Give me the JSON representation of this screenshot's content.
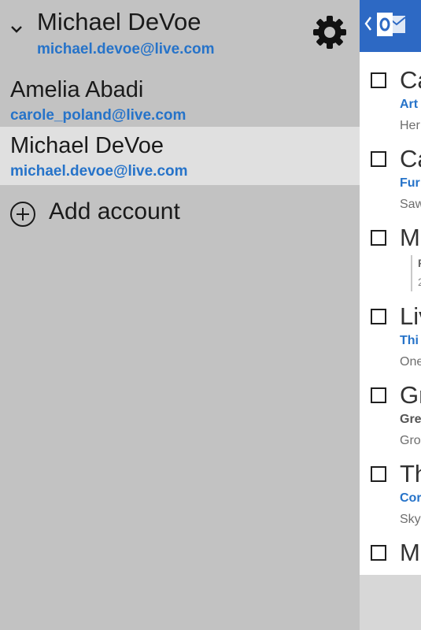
{
  "header": {
    "name": "Michael DeVoe",
    "email": "michael.devoe@live.com"
  },
  "accounts": [
    {
      "name": "Amelia Abadi",
      "email": "carole_poland@live.com",
      "selected": false
    },
    {
      "name": "Michael DeVoe",
      "email": "michael.devoe@live.com",
      "selected": true
    }
  ],
  "add_account": {
    "label": "Add account"
  },
  "mail_list": {
    "items": [
      {
        "sender": "Ca",
        "subject": "Art",
        "preview": "Her",
        "subject_color": "#2673c9"
      },
      {
        "sender": "Ca",
        "subject": "Fur",
        "preview": "Saw",
        "subject_color": "#2673c9"
      },
      {
        "sender": "M",
        "quote_line1": "F",
        "quote_line2": "2"
      },
      {
        "sender": "Liv",
        "subject": "Thi",
        "preview": "One",
        "subject_color": "#2673c9"
      },
      {
        "sender": "Gr",
        "subject": "Gre",
        "preview": "Gro",
        "subject_color": "#555555"
      },
      {
        "sender": "Th",
        "subject": "Cor",
        "preview": "Sky",
        "subject_color": "#2673c9"
      },
      {
        "sender": "M"
      }
    ]
  },
  "colors": {
    "drawer_bg": "#c2c2c2",
    "selected_bg": "#e0e0e0",
    "accent_blue": "#2673c9",
    "app_bar": "#2d69c4"
  },
  "icons": {
    "collapse": "chevron-down-icon",
    "settings": "gear-icon",
    "add": "plus-circle-icon",
    "back": "chevron-left-icon",
    "app": "outlook-logo-icon"
  }
}
